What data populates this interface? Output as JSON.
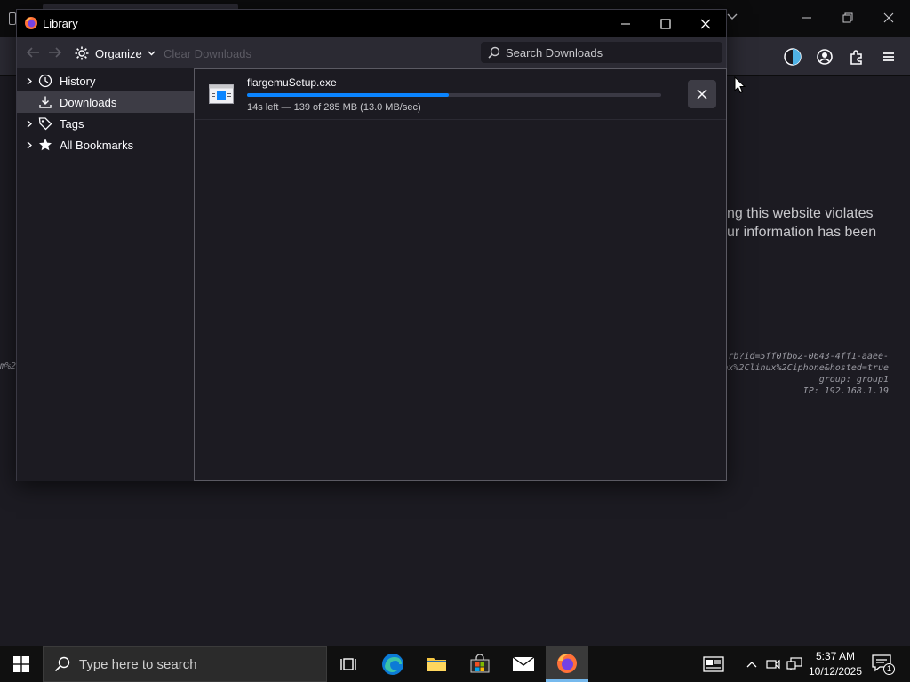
{
  "library": {
    "title": "Library",
    "toolbar": {
      "organize_label": "Organize",
      "clear_downloads_label": "Clear Downloads",
      "search_placeholder": "Search Downloads",
      "search_value": ""
    },
    "sidebar": {
      "items": [
        {
          "label": "History",
          "icon": "clock-icon",
          "expandable": true,
          "selected": false
        },
        {
          "label": "Downloads",
          "icon": "download-icon",
          "expandable": false,
          "selected": true
        },
        {
          "label": "Tags",
          "icon": "tag-icon",
          "expandable": true,
          "selected": false
        },
        {
          "label": "All Bookmarks",
          "icon": "star-icon",
          "expandable": true,
          "selected": false
        }
      ]
    },
    "downloads": [
      {
        "filename": "flargemuSetup.exe",
        "status": "14s left — 139 of 285 MB (13.0 MB/sec)",
        "progress_fraction": 0.488
      }
    ]
  },
  "background_page": {
    "warning_lines": [
      "ng this website violates",
      "ur information has been"
    ],
    "info_lines": [
      "rb?id=5ff0fb62-0643-4ff1-aaee-",
      "ax%2Clinux%2Ciphone&hosted=true",
      "group: group1",
      "IP: 192.168.1.19"
    ],
    "left_fragment": "m%2"
  },
  "taskbar": {
    "search_placeholder": "Type here to search",
    "clock_time": "5:37 AM",
    "clock_date": "10/12/2025",
    "notification_count": "1"
  },
  "colors": {
    "accent": "#0a84ff",
    "taskbar_active": "#76b9ed"
  }
}
